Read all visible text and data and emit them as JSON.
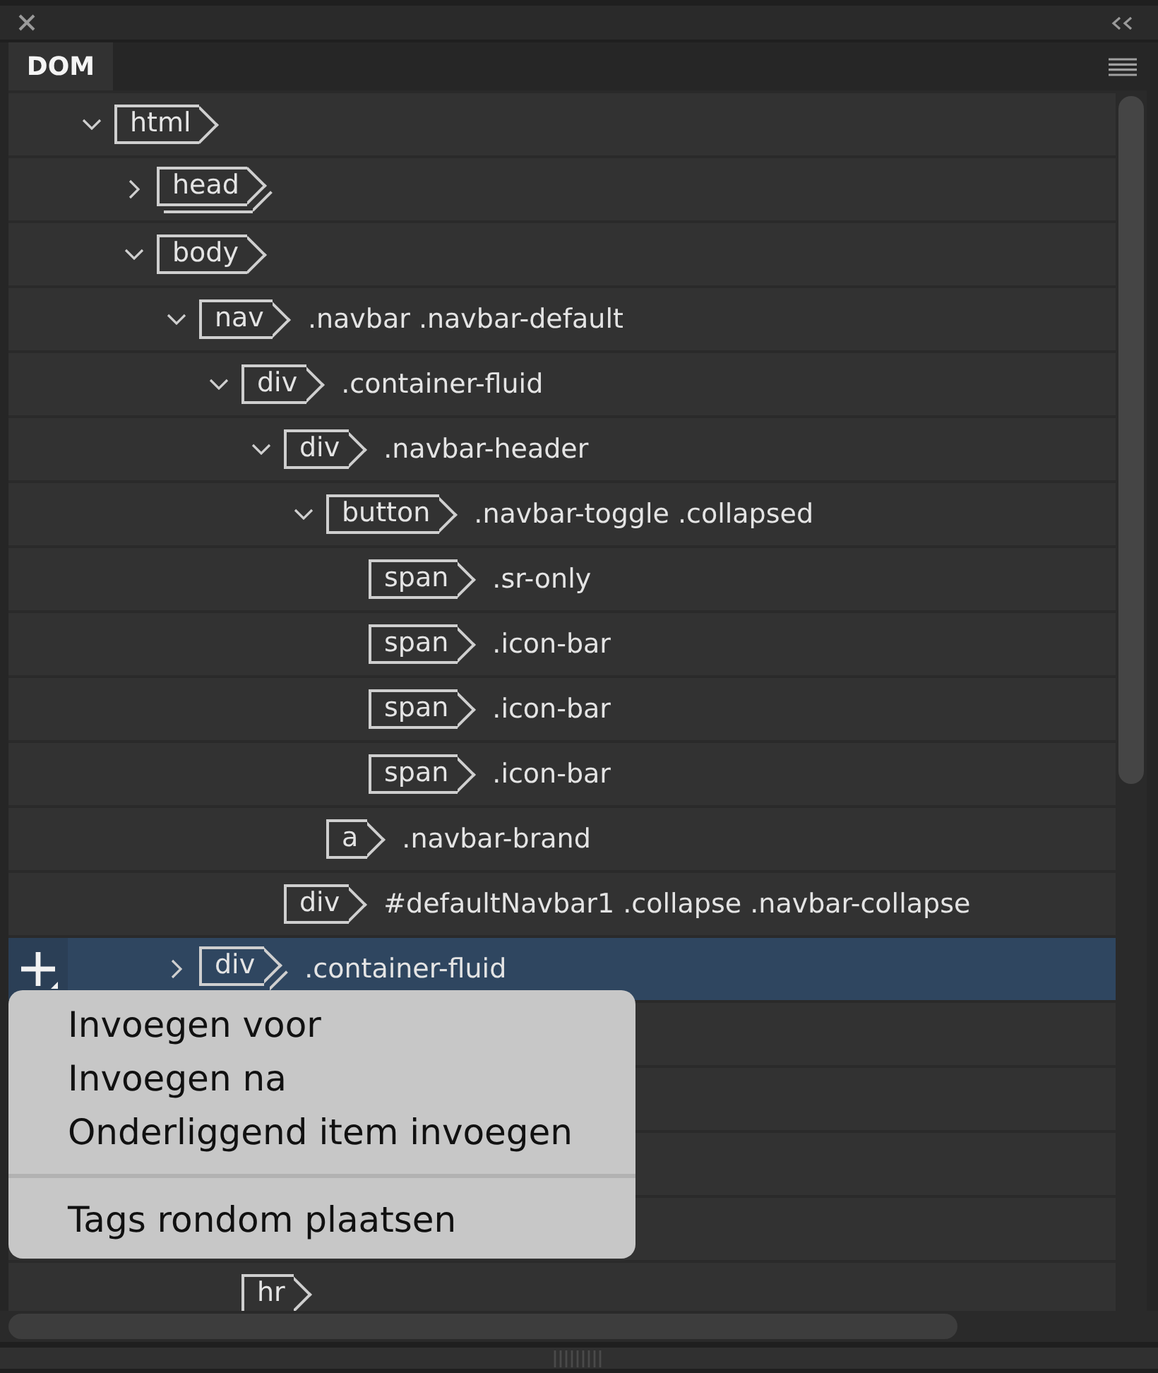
{
  "panel": {
    "tabs": [
      {
        "label": "DOM",
        "selected": true
      }
    ]
  },
  "tree": [
    {
      "tag": "html",
      "expanded": true,
      "selected": false,
      "children": [
        {
          "tag": "head",
          "expanded": false,
          "selected": false
        },
        {
          "tag": "body",
          "expanded": true,
          "selected": false,
          "children": [
            {
              "tag": "nav",
              "selector": ".navbar .navbar-default",
              "expanded": true,
              "selected": false,
              "children": [
                {
                  "tag": "div",
                  "selector": ".container-fluid",
                  "expanded": true,
                  "selected": false,
                  "children": [
                    {
                      "tag": "div",
                      "selector": ".navbar-header",
                      "expanded": true,
                      "selected": false,
                      "children": [
                        {
                          "tag": "button",
                          "selector": ".navbar-toggle .collapsed",
                          "expanded": true,
                          "selected": false,
                          "children": [
                            {
                              "tag": "span",
                              "selector": ".sr-only",
                              "selected": false
                            },
                            {
                              "tag": "span",
                              "selector": ".icon-bar",
                              "selected": false
                            },
                            {
                              "tag": "span",
                              "selector": ".icon-bar",
                              "selected": false
                            },
                            {
                              "tag": "span",
                              "selector": ".icon-bar",
                              "selected": false
                            }
                          ]
                        },
                        {
                          "tag": "a",
                          "selector": ".navbar-brand",
                          "selected": false
                        }
                      ]
                    },
                    {
                      "tag": "div",
                      "selector": "#defaultNavbar1 .collapse .navbar-collapse",
                      "selected": false
                    }
                  ]
                }
              ]
            },
            {
              "tag": "div",
              "selector": ".container-fluid",
              "expanded": false,
              "selected": true
            },
            {
              "selected": false,
              "children": [
                {
                  "selected": false
                },
                {
                  "selected": false
                },
                {
                  "selected": false
                },
                {
                  "tag": "hr",
                  "selected": false
                }
              ]
            }
          ]
        }
      ]
    }
  ],
  "context_menu": {
    "items": [
      {
        "kind": "item",
        "label": "Invoegen voor"
      },
      {
        "kind": "item",
        "label": "Invoegen na"
      },
      {
        "kind": "item",
        "label": "Onderliggend item invoegen"
      },
      {
        "kind": "separator"
      },
      {
        "kind": "item",
        "label": "Tags rondom plaatsen"
      }
    ]
  }
}
